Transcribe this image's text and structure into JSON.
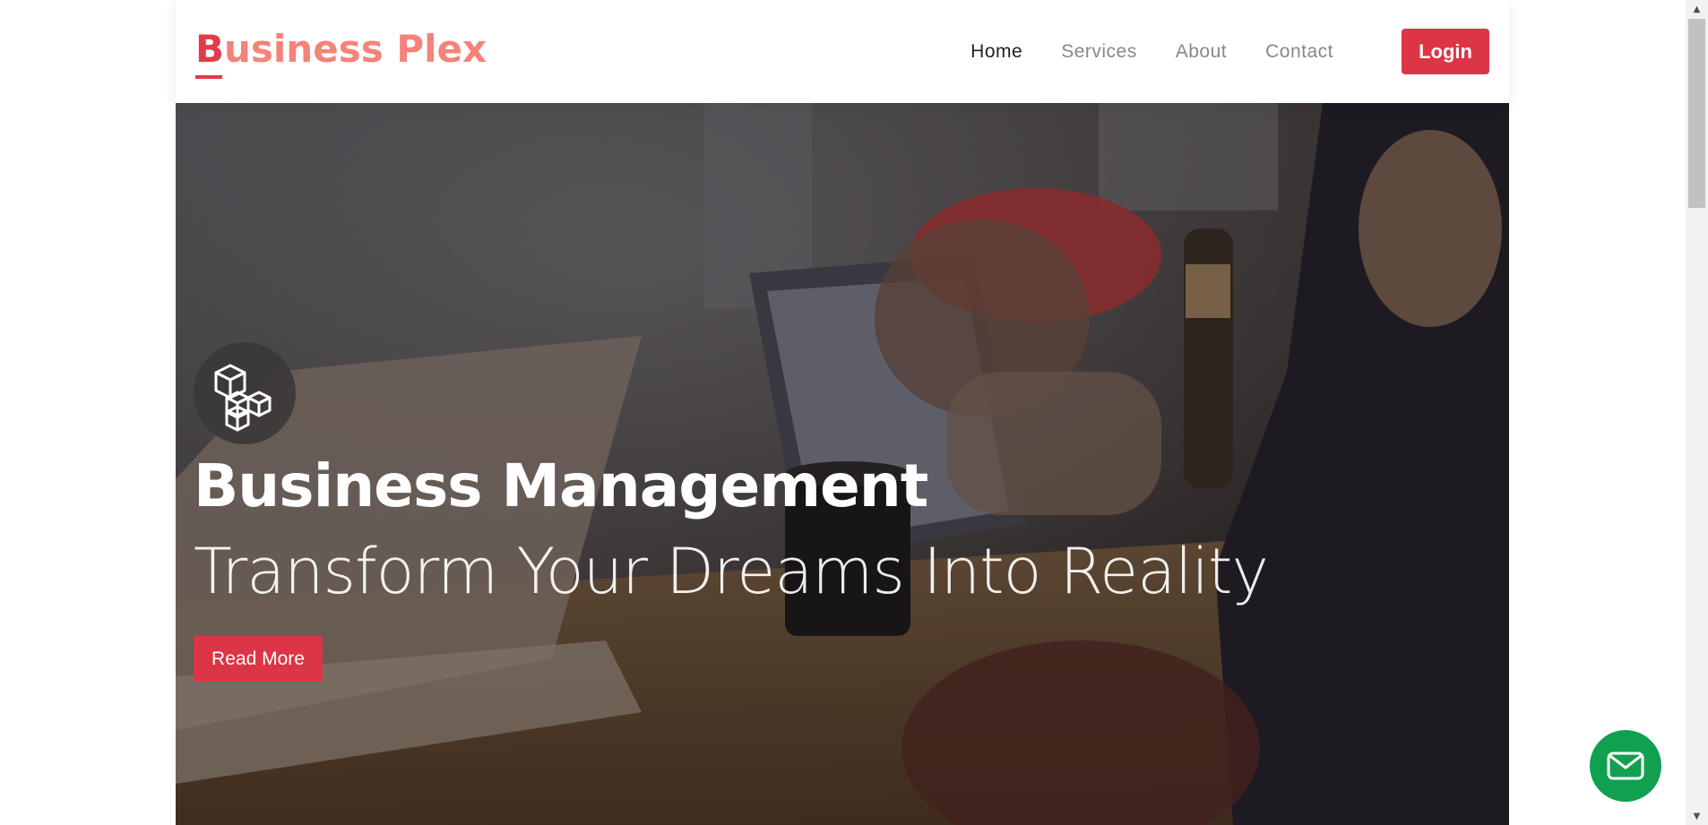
{
  "navbar": {
    "logo_first": "B",
    "logo_rest": "usiness Plex",
    "links": [
      {
        "label": "Home",
        "active": true
      },
      {
        "label": "Services",
        "active": false
      },
      {
        "label": "About",
        "active": false
      },
      {
        "label": "Contact",
        "active": false
      }
    ],
    "login_label": "Login"
  },
  "hero": {
    "icon": "stacked-cubes-icon",
    "title": "Business Management",
    "subtitle": "Transform Your Dreams Into Reality",
    "cta_label": "Read More"
  },
  "floating_button": {
    "icon": "mail-icon"
  },
  "colors": {
    "accent": "#dc3545",
    "logo": "#f3837b",
    "logo_first_letter": "#e23a48",
    "nav_active": "#222222",
    "nav_inactive": "#888888",
    "fab": "#11a04f"
  }
}
